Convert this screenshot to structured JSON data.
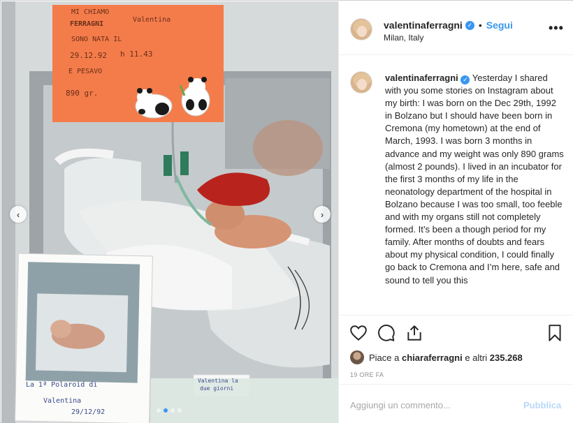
{
  "post": {
    "username": "valentinaferragni",
    "follow_label": "Segui",
    "location": "Milan, Italy",
    "more_label": "•••"
  },
  "caption": {
    "username": "valentinaferragni",
    "text": "Yesterday I shared with you some stories on Instagram about my birth: I was born on the Dec 29th, 1992 in Bolzano but I should have been born in Cremona (my hometown) at the end of March, 1993. I was born 3 months in advance and my weight was only 890 grams (almost 2 pounds). I lived in an incubator for the first 3 months of my life in the neonatology department of the hospital in Bolzano because I was too small, too feeble and with my organs still not completely formed. It’s been a though period for my family. After months of doubts and fears about my physical condition, I could finally go back to Cremona and I’m here, safe and sound to tell you this"
  },
  "likes": {
    "prefix": "Piace a",
    "user": "chiaraferragni",
    "middle": "e altri",
    "count": "235.268"
  },
  "timestamp": "19 ORE FA",
  "comment": {
    "placeholder": "Aggiungi un commento...",
    "publish_label": "Pubblica"
  },
  "media": {
    "card_lines": [
      "MI CHIAMO",
      "FERRAGNI",
      "Valentina",
      "SONO NATA IL",
      "29.12.92",
      "h 11.43",
      "E PESAVO",
      "890 gr."
    ],
    "polaroid_caption": [
      "La 1ª Polaroid di",
      "Valentina",
      "29/12/92"
    ],
    "note_text": [
      "Valentina la",
      "due giorni"
    ],
    "carousel_total": 4,
    "carousel_active": 1
  },
  "icons": {
    "like": "heart-icon",
    "comment": "comment-icon",
    "share": "share-icon",
    "save": "bookmark-icon",
    "prev": "chevron-left-icon",
    "next": "chevron-right-icon",
    "verified": "verified-badge-icon"
  },
  "colors": {
    "accent": "#3897f0",
    "publish_disabled": "#b8d8f8",
    "card_orange": "#f47c4b"
  }
}
